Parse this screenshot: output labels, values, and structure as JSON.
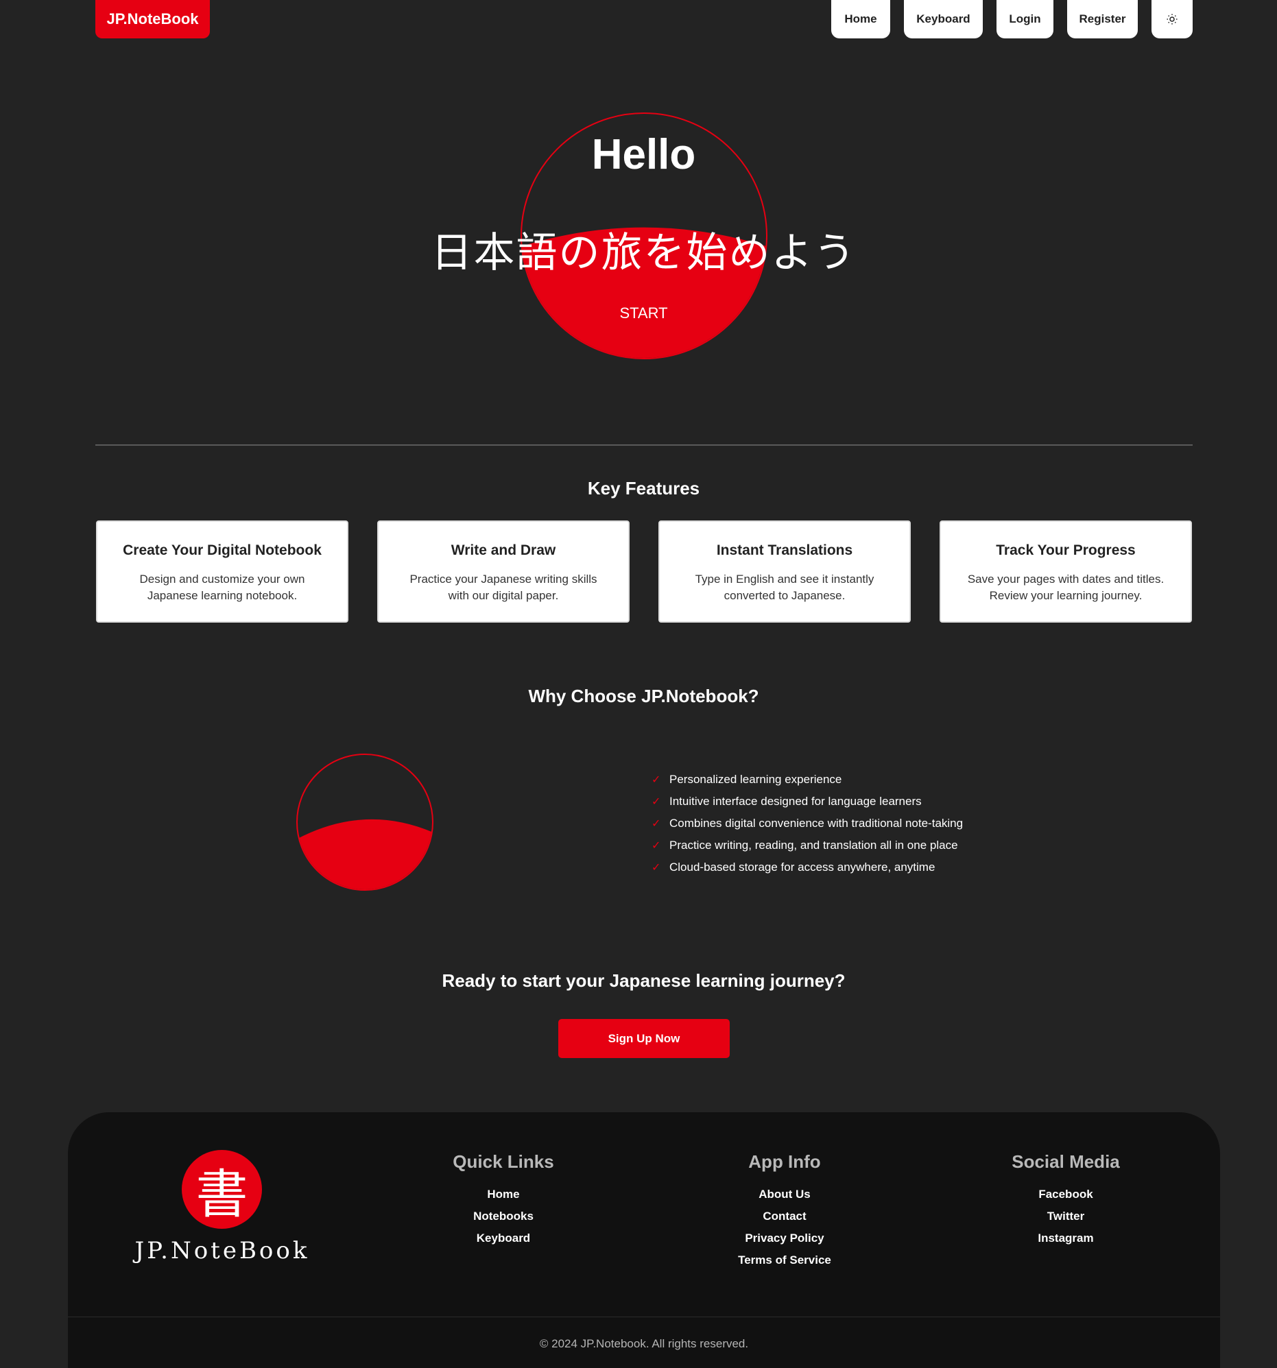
{
  "header": {
    "brand": "JP.NoteBook",
    "nav": [
      "Home",
      "Keyboard",
      "Login",
      "Register"
    ],
    "theme_icon": "sun-icon"
  },
  "hero": {
    "hello": "Hello",
    "subtitle_jp": "日本語の旅を始めよう",
    "start": "START"
  },
  "features": {
    "title": "Key Features",
    "cards": [
      {
        "title": "Create Your Digital Notebook",
        "desc_line1": "Design and customize your own",
        "desc_line2": "Japanese learning notebook."
      },
      {
        "title": "Write and Draw",
        "desc_line1": "Practice your Japanese writing skills",
        "desc_line2": "with our digital paper."
      },
      {
        "title": "Instant Translations",
        "desc_line1": "Type in English and see it instantly",
        "desc_line2": "converted to Japanese."
      },
      {
        "title": "Track Your Progress",
        "desc_line1": "Save your pages with dates and titles.",
        "desc_line2": "Review your learning journey."
      }
    ]
  },
  "why": {
    "title": "Why Choose JP.Notebook?",
    "check": "✓",
    "items": [
      "Personalized learning experience",
      "Intuitive interface designed for language learners",
      "Combines digital convenience with traditional note-taking",
      "Practice writing, reading, and translation all in one place",
      "Cloud-based storage for access anywhere, anytime"
    ]
  },
  "cta": {
    "title": "Ready to start your Japanese learning journey?",
    "button": "Sign Up Now"
  },
  "footer": {
    "logo_char": "書",
    "logo_text": "JP.NoteBook",
    "quick_links": {
      "title": "Quick Links",
      "links": [
        "Home",
        "Notebooks",
        "Keyboard"
      ]
    },
    "app_info": {
      "title": "App Info",
      "links": [
        "About Us",
        "Contact",
        "Privacy Policy",
        "Terms of Service"
      ]
    },
    "social": {
      "title": "Social Media",
      "links": [
        "Facebook",
        "Twitter",
        "Instagram"
      ]
    },
    "copyright": "© 2024 JP.Notebook. All rights reserved."
  },
  "colors": {
    "accent": "#e60012",
    "background": "#232323",
    "footer": "#111111"
  }
}
